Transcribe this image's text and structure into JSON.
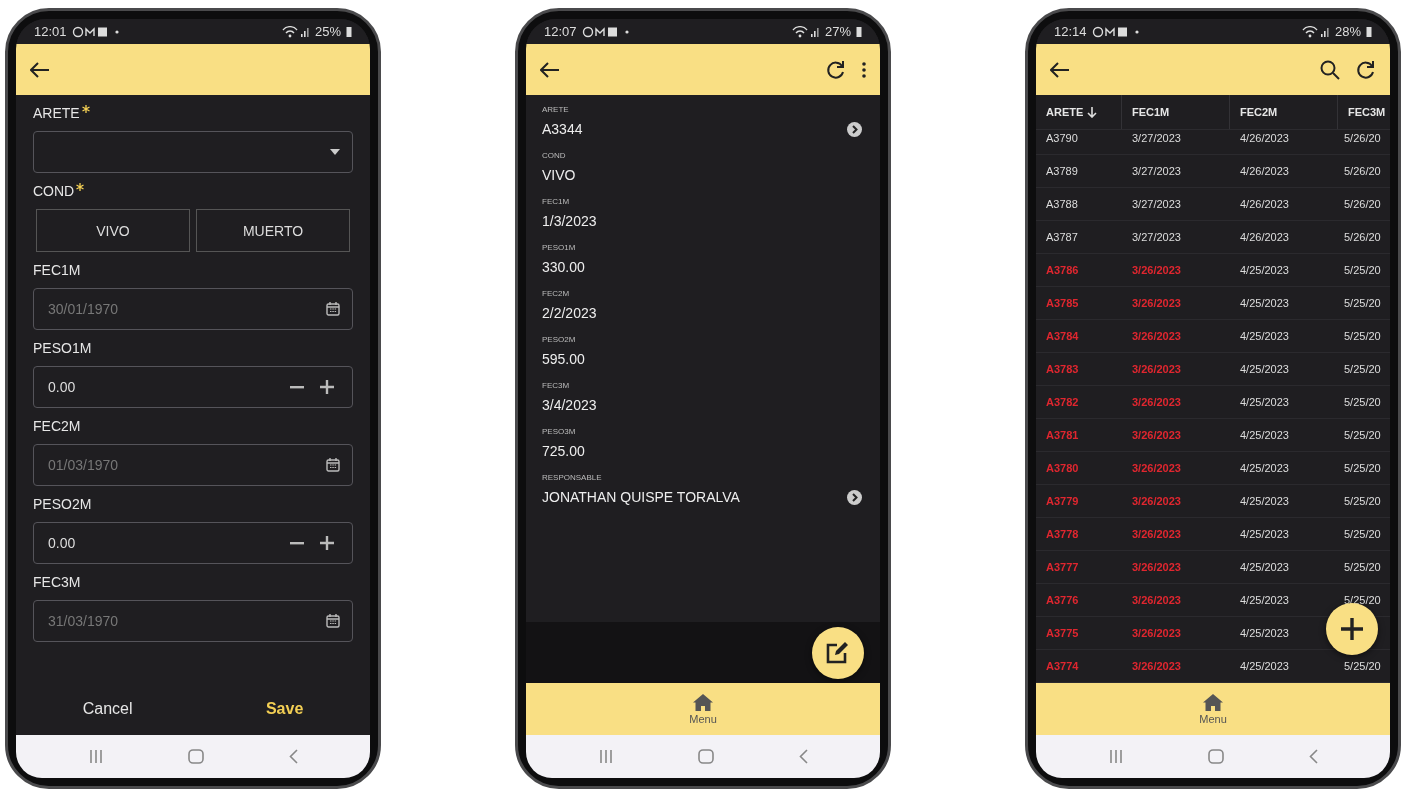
{
  "phones": [
    {
      "kind": "form",
      "status_bar": {
        "time": "12:01",
        "battery": "25%"
      },
      "fields": [
        {
          "kind": "select",
          "label": "ARETE",
          "required": true
        },
        {
          "kind": "segmented",
          "label": "COND",
          "required": true,
          "options": [
            {
              "label": "VIVO",
              "selected": false
            },
            {
              "label": "MUERTO",
              "selected": false
            }
          ]
        },
        {
          "kind": "date",
          "label": "FEC1M",
          "required": false,
          "placeholder": "30/01/1970"
        },
        {
          "kind": "number",
          "label": "PESO1M",
          "required": false,
          "value": "0.00"
        },
        {
          "kind": "date",
          "label": "FEC2M",
          "required": false,
          "placeholder": "01/03/1970"
        },
        {
          "kind": "number",
          "label": "PESO2M",
          "required": false,
          "value": "0.00"
        },
        {
          "kind": "date",
          "label": "FEC3M",
          "required": false,
          "placeholder": "31/03/1970"
        }
      ],
      "footer": {
        "cancel": "Cancel",
        "save": "Save"
      }
    },
    {
      "kind": "detail",
      "status_bar": {
        "time": "12:07",
        "battery": "27%"
      },
      "app_bar": {
        "actions": [
          {
            "kind": "refresh"
          },
          {
            "kind": "more"
          }
        ]
      },
      "fields": [
        {
          "label": "ARETE",
          "value": "A3344",
          "link": true
        },
        {
          "label": "COND",
          "value": "VIVO",
          "link": false
        },
        {
          "label": "FEC1M",
          "value": "1/3/2023",
          "link": false
        },
        {
          "label": "PESO1M",
          "value": "330.00",
          "link": false
        },
        {
          "label": "FEC2M",
          "value": "2/2/2023",
          "link": false
        },
        {
          "label": "PESO2M",
          "value": "595.00",
          "link": false
        },
        {
          "label": "FEC3M",
          "value": "3/4/2023",
          "link": false
        },
        {
          "label": "PESO3M",
          "value": "725.00",
          "link": false
        },
        {
          "label": "RESPONSABLE",
          "value": "JONATHAN QUISPE TORALVA",
          "link": true
        }
      ],
      "fab": {
        "kind": "edit"
      },
      "bottom_nav": {
        "label": "Menu"
      }
    },
    {
      "kind": "table",
      "status_bar": {
        "time": "12:14",
        "battery": "28%"
      },
      "app_bar": {
        "actions": [
          {
            "kind": "search"
          },
          {
            "kind": "refresh"
          }
        ]
      },
      "columns": [
        {
          "label": "ARETE",
          "sorted": true
        },
        {
          "label": "FEC1M",
          "sorted": false
        },
        {
          "label": "FEC2M",
          "sorted": false
        },
        {
          "label": "FEC3M",
          "sorted": false
        }
      ],
      "rows": [
        {
          "alert": false,
          "cells": [
            "A3790",
            "3/27/2023",
            "4/26/2023",
            "5/26/20"
          ]
        },
        {
          "alert": false,
          "cells": [
            "A3789",
            "3/27/2023",
            "4/26/2023",
            "5/26/20"
          ]
        },
        {
          "alert": false,
          "cells": [
            "A3788",
            "3/27/2023",
            "4/26/2023",
            "5/26/20"
          ]
        },
        {
          "alert": false,
          "cells": [
            "A3787",
            "3/27/2023",
            "4/26/2023",
            "5/26/20"
          ]
        },
        {
          "alert": true,
          "cells": [
            "A3786",
            "3/26/2023",
            "4/25/2023",
            "5/25/20"
          ]
        },
        {
          "alert": true,
          "cells": [
            "A3785",
            "3/26/2023",
            "4/25/2023",
            "5/25/20"
          ]
        },
        {
          "alert": true,
          "cells": [
            "A3784",
            "3/26/2023",
            "4/25/2023",
            "5/25/20"
          ]
        },
        {
          "alert": true,
          "cells": [
            "A3783",
            "3/26/2023",
            "4/25/2023",
            "5/25/20"
          ]
        },
        {
          "alert": true,
          "cells": [
            "A3782",
            "3/26/2023",
            "4/25/2023",
            "5/25/20"
          ]
        },
        {
          "alert": true,
          "cells": [
            "A3781",
            "3/26/2023",
            "4/25/2023",
            "5/25/20"
          ]
        },
        {
          "alert": true,
          "cells": [
            "A3780",
            "3/26/2023",
            "4/25/2023",
            "5/25/20"
          ]
        },
        {
          "alert": true,
          "cells": [
            "A3779",
            "3/26/2023",
            "4/25/2023",
            "5/25/20"
          ]
        },
        {
          "alert": true,
          "cells": [
            "A3778",
            "3/26/2023",
            "4/25/2023",
            "5/25/20"
          ]
        },
        {
          "alert": true,
          "cells": [
            "A3777",
            "3/26/2023",
            "4/25/2023",
            "5/25/20"
          ]
        },
        {
          "alert": true,
          "cells": [
            "A3776",
            "3/26/2023",
            "4/25/2023",
            "5/25/20"
          ]
        },
        {
          "alert": true,
          "cells": [
            "A3775",
            "3/26/2023",
            "4/25/2023"
          ]
        },
        {
          "alert": true,
          "cells": [
            "A3774",
            "3/26/2023",
            "4/25/2023",
            "5/25/20"
          ]
        }
      ],
      "fab": {
        "kind": "add"
      },
      "bottom_nav": {
        "label": "Menu"
      }
    }
  ]
}
